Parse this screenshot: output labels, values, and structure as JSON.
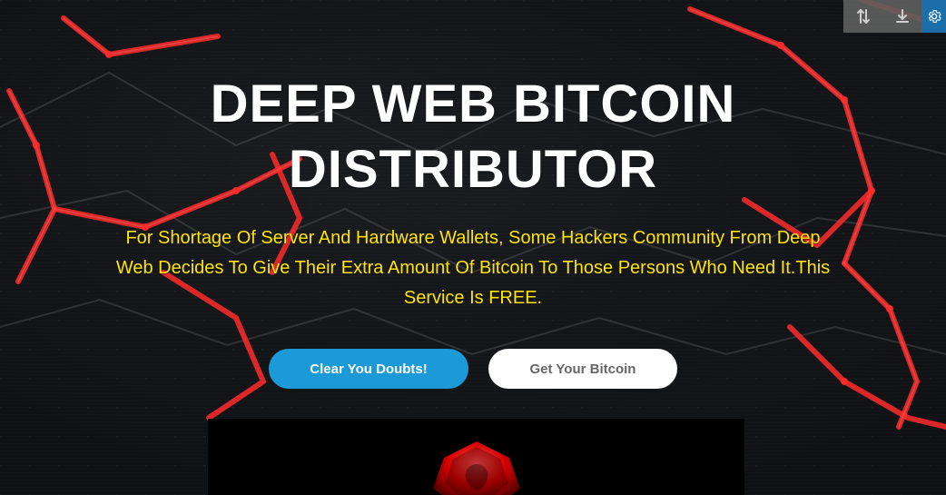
{
  "toolbar": {
    "icons": [
      "sort-arrows-icon",
      "download-icon",
      "gear-icon"
    ],
    "colors": {
      "tool_bg": "#5f5f5f",
      "gear_bg": "#1c6ea8",
      "icon_fg": "#cfcfcf"
    }
  },
  "hero": {
    "title_line1": "DEEP WEB BITCOIN",
    "title_line2": "DISTRIBUTOR",
    "subtitle": "For Shortage Of Server And Hardware Wallets, Some Hackers Community From Deep Web Decides To Give Their Extra Amount Of Bitcoin To Those Persons Who Need It.This Service Is FREE.",
    "colors": {
      "title": "#ffffff",
      "subtitle": "#ffe600"
    }
  },
  "cta": {
    "primary_label": "Clear You Doubts!",
    "secondary_label": "Get Your Bitcoin",
    "colors": {
      "primary_bg": "#1b9ad7",
      "secondary_bg": "#ffffff",
      "secondary_fg": "#666666"
    }
  },
  "media": {
    "emblem_icon": "red-emblem-icon"
  },
  "background": {
    "icons": [
      "red-network-lines-icon"
    ]
  }
}
